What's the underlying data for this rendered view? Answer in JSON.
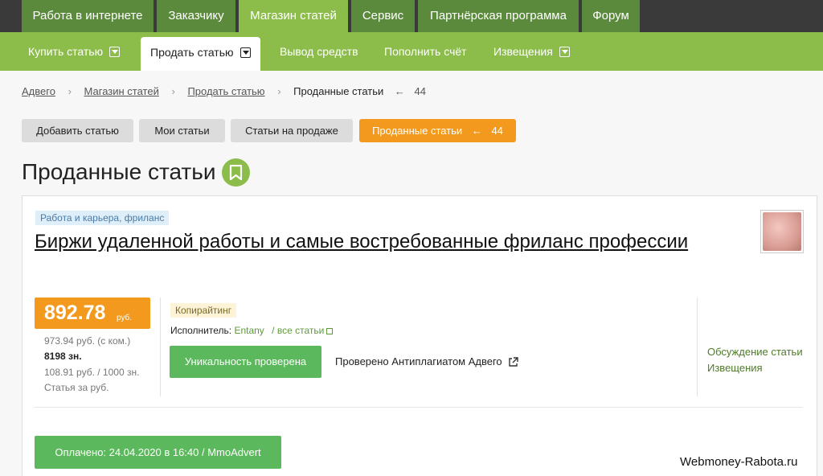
{
  "top_nav": [
    "Работа в интернете",
    "Заказчику",
    "Магазин статей",
    "Сервис",
    "Партнёрская программа",
    "Форум"
  ],
  "sub_nav": [
    "Купить статью",
    "Продать статью",
    "Вывод средств",
    "Пополнить счёт",
    "Извещения"
  ],
  "breadcrumb": {
    "items": [
      "Адвего",
      "Магазин статей",
      "Продать статью"
    ],
    "current": "Проданные статьи",
    "count": "44"
  },
  "buttons": {
    "add": "Добавить статью",
    "mine": "Мои статьи",
    "on_sale": "Статьи на продаже",
    "sold": "Проданные статьи",
    "sold_count": "44"
  },
  "page_title": "Проданные статьи",
  "article": {
    "tag": "Работа и карьера, фриланс",
    "title": "Биржи удаленной работы и самые востребованные фриланс профессии",
    "price": "892.78",
    "price_currency": "руб.",
    "price_with_commission": "973.94 руб. (с ком.)",
    "chars": "8198 зн.",
    "per_thousand": "108.91 руб. / 1000 зн.",
    "label": "Статья за руб.",
    "category": "Копирайтинг",
    "performer_label": "Исполнитель:",
    "performer_name": "Entany",
    "all_articles": "все статьи",
    "uniqueness_button": "Уникальность проверена",
    "antiplagiat": "Проверено Антиплагиатом Адвего",
    "discussion": "Обсуждение статьи",
    "notices": "Извещения",
    "paid": "Оплачено: 24.04.2020 в 16:40 / MmoAdvert"
  },
  "watermark": "Webmoney-Rabota.ru",
  "colors": {
    "dark_green": "#5c8a3c",
    "light_green": "#8cbd4b",
    "orange": "#f39a1e",
    "button_green": "#5cb85c"
  }
}
